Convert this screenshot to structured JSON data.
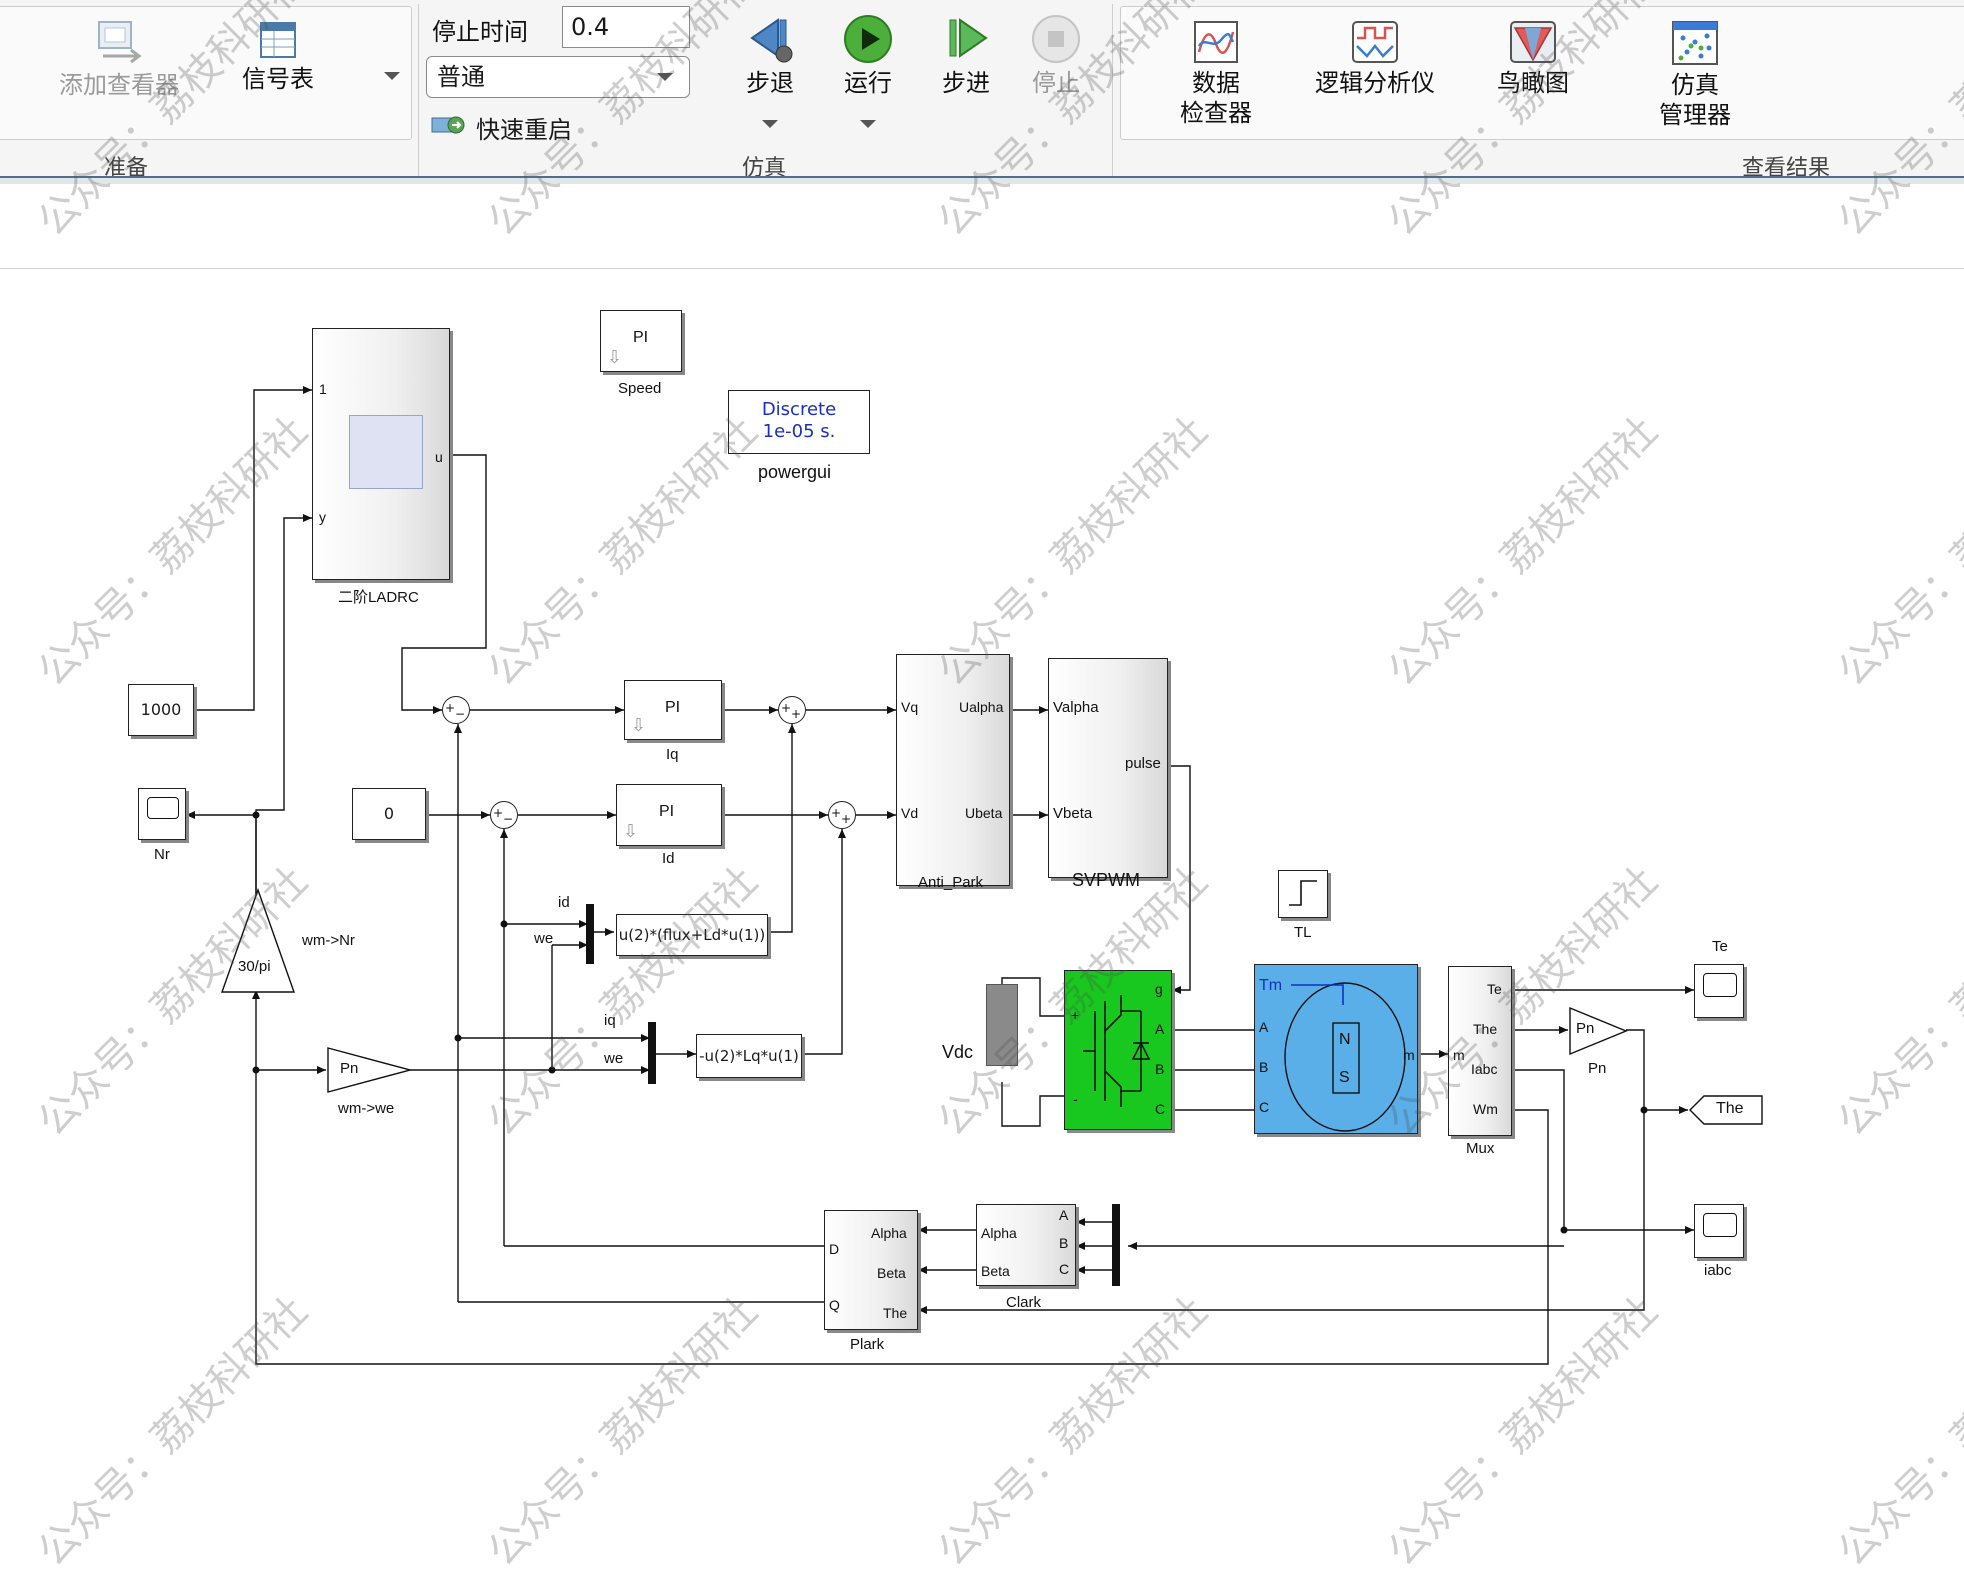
{
  "ribbon": {
    "prepare": {
      "section_label": "准备",
      "add_viewer_label": "添加查看器",
      "signal_table_label": "信号表"
    },
    "simulation": {
      "section_label": "仿真",
      "stop_time_label": "停止时间",
      "stop_time_value": "0.4",
      "mode_value": "普通",
      "fast_restart_label": "快速重启",
      "step_back_label": "步退",
      "run_label": "运行",
      "step_forward_label": "步进",
      "stop_label": "停止"
    },
    "review": {
      "section_label": "查看结果",
      "data_inspector_label_1": "数据",
      "data_inspector_label_2": "检查器",
      "logic_analyzer_label": "逻辑分析仪",
      "birdseye_label": "鸟瞰图",
      "sim_manager_label_1": "仿真",
      "sim_manager_label_2": "管理器"
    }
  },
  "diagram": {
    "ladrc": {
      "name": "二阶LADRC",
      "port_in1": "1",
      "port_in2": "y",
      "port_out": "u"
    },
    "speed_pi": {
      "text": "PI",
      "name": "Speed"
    },
    "powergui": {
      "line1": "Discrete",
      "line2": "1e-05 s.",
      "name": "powergui"
    },
    "const_1000": {
      "value": "1000"
    },
    "const_0": {
      "value": "0"
    },
    "scope_nr": {
      "name": "Nr"
    },
    "gain_30pi": {
      "text": "30/pi",
      "name": "wm->Nr"
    },
    "gain_pn_we": {
      "text": "Pn",
      "name": "wm->we"
    },
    "pi_iq": {
      "text": "PI",
      "name": "Iq"
    },
    "pi_id": {
      "text": "PI",
      "name": "Id"
    },
    "fcn_q": {
      "text": "u(2)*(flux+Ld*u(1))"
    },
    "fcn_d": {
      "text": "-u(2)*Lq*u(1)"
    },
    "mux_labels": {
      "id": "id",
      "we": "we",
      "iq": "iq",
      "we2": "we"
    },
    "anti_park": {
      "name": "Anti_Park",
      "vq": "Vq",
      "vd": "Vd",
      "ualpha": "Ualpha",
      "ubeta": "Ubeta"
    },
    "svpwm": {
      "name": "SVPWM",
      "valpha": "Valpha",
      "vbeta": "Vbeta",
      "pulse": "pulse"
    },
    "tl": {
      "name": "TL"
    },
    "vdc": {
      "name": "Vdc",
      "plus": "+",
      "minus": "-"
    },
    "inverter": {
      "g": "g",
      "a": "A",
      "b": "B",
      "c": "C"
    },
    "motor": {
      "tm": "Tm",
      "a": "A",
      "b": "B",
      "c": "C",
      "m": "m",
      "n": "N",
      "s": "S"
    },
    "bus_mux": {
      "name": "Mux",
      "m": "m",
      "te": "Te",
      "the": "The",
      "iabc": "Iabc",
      "wm": "Wm"
    },
    "scope_te": {
      "name": "Te"
    },
    "gain_pn": {
      "text": "Pn",
      "name": "Pn"
    },
    "goto_the": {
      "text": "The"
    },
    "scope_iabc": {
      "name": "iabc"
    },
    "clark": {
      "name": "Clark",
      "a": "A",
      "b": "B",
      "c": "C",
      "alpha": "Alpha",
      "beta": "Beta"
    },
    "plark": {
      "name": "Plark",
      "d": "D",
      "q": "Q",
      "alpha": "Alpha",
      "beta": "Beta",
      "the": "The"
    }
  },
  "watermark": "公众号：荔枝科研社"
}
